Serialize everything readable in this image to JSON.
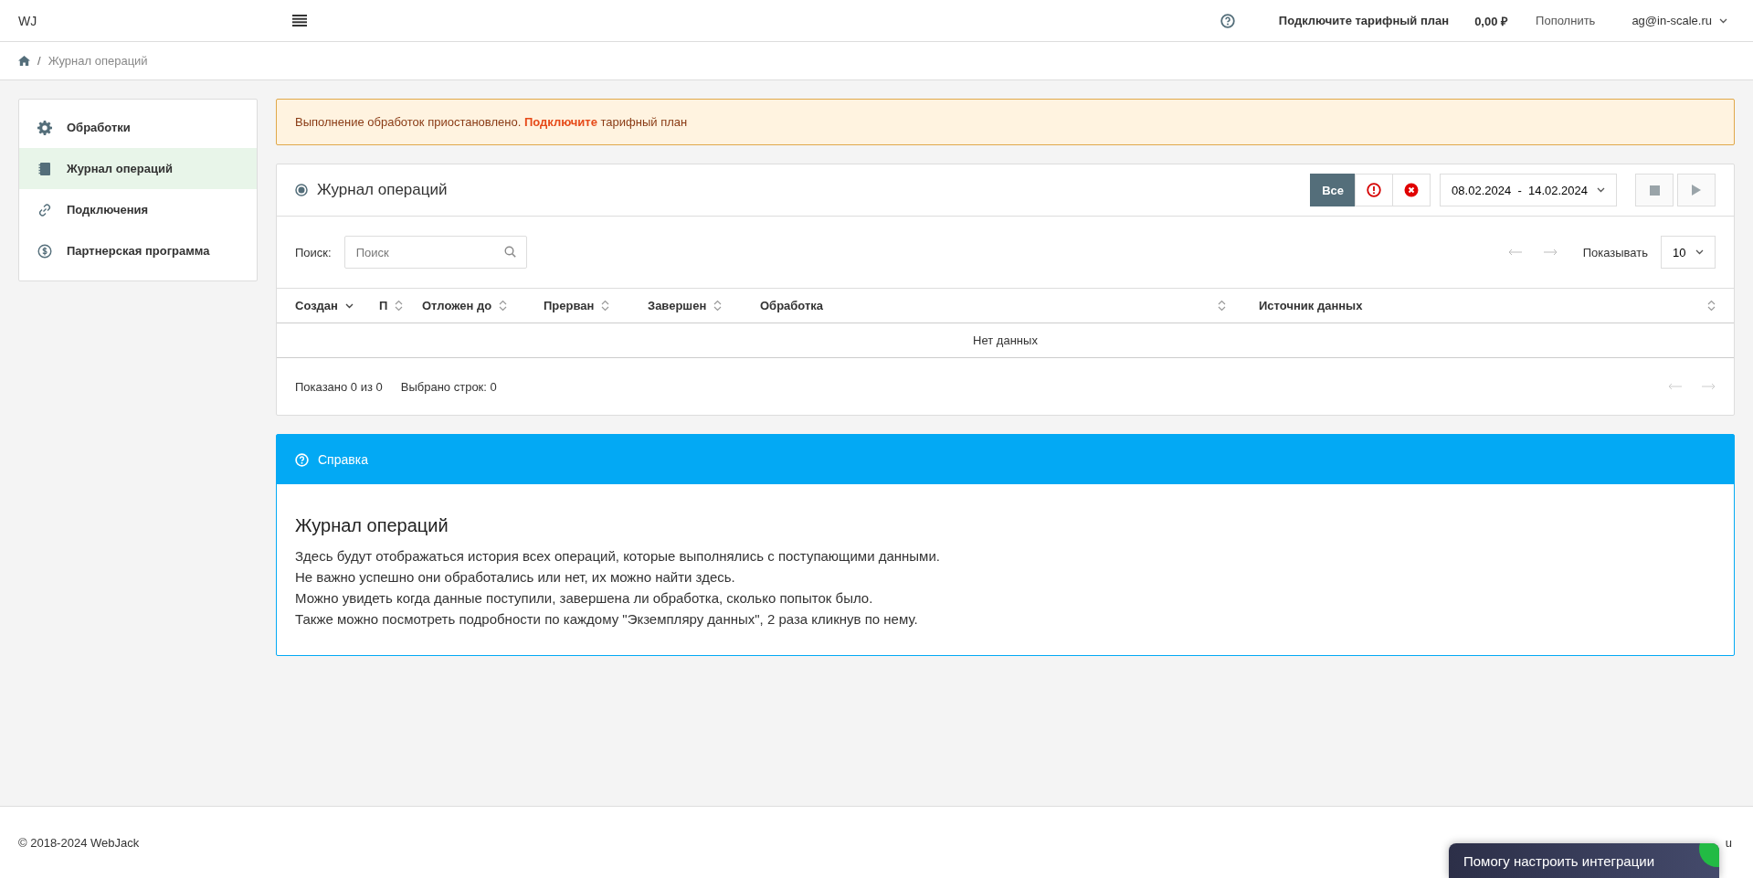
{
  "header": {
    "logo": "WJ",
    "plan_link": "Подключите тарифный план",
    "balance": "0,00 ₽",
    "topup": "Пополнить",
    "user": "ag@in-scale.ru"
  },
  "breadcrumb": {
    "separator": "/",
    "current": "Журнал операций"
  },
  "sidebar": {
    "items": [
      {
        "label": "Обработки",
        "selected": false
      },
      {
        "label": "Журнал операций",
        "selected": true
      },
      {
        "label": "Подключения",
        "selected": false
      },
      {
        "label": "Партнерская программа",
        "selected": false
      }
    ]
  },
  "alert": {
    "text": "Выполнение обработок приостановлено. **Подключите** тарифный план"
  },
  "journal": {
    "title": "Журнал операций",
    "filters": [
      {
        "kind": "text",
        "label": "Все",
        "selected": true
      },
      {
        "kind": "warning",
        "selected": false
      },
      {
        "kind": "error",
        "selected": false
      }
    ],
    "date_range": "08.02.2024  -  14.02.2024",
    "search_label": "Поиск:",
    "search": {
      "placeholder": "Поиск"
    },
    "page_size_label": "Показывать",
    "page_size": "10",
    "columns": [
      {
        "label": "Создан",
        "sorted": true
      },
      {
        "label": "П",
        "sorted": false
      },
      {
        "label": "Отложен до",
        "sorted": false
      },
      {
        "label": "Прерван",
        "sorted": false
      },
      {
        "label": "Завершен",
        "sorted": false
      },
      {
        "label": "Обработка",
        "sorted": false
      },
      {
        "label": "Источник данных",
        "sorted": false
      }
    ],
    "empty": "Нет данных",
    "shown": "Показано 0 из 0",
    "selected_rows": "Выбрано строк: 0"
  },
  "help": {
    "header": "Справка",
    "title": "Журнал операций",
    "lines": [
      "Здесь будут отображаться история всех операций, которые выполнялись с поступающими данными.",
      "Не важно успешно они обработались или нет, их можно найти здесь.",
      "Можно увидеть когда данные поступили, завершена ли обработка, сколько попыток было.",
      "Также можно посмотреть подробности по каждому \"Экземпляру данных\", 2 раза кликнув по нему."
    ]
  },
  "footer": {
    "copyright": "© 2018-2024 WebJack",
    "right": "u"
  },
  "chat_widget": {
    "text": "Помогу настроить интеграции"
  }
}
